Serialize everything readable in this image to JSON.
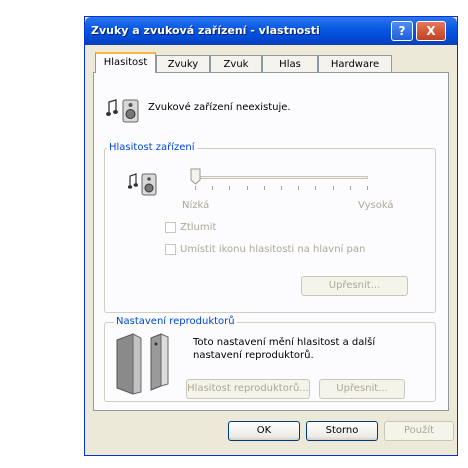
{
  "window": {
    "title": "Zvuky a zvuková zařízení - vlastnosti"
  },
  "titlebar": {
    "help_glyph": "?",
    "close_glyph": "X"
  },
  "tabs": [
    {
      "label": "Hlasitost",
      "active": true
    },
    {
      "label": "Zvuky"
    },
    {
      "label": "Zvuk"
    },
    {
      "label": "Hlas"
    },
    {
      "label": "Hardware"
    }
  ],
  "device": {
    "status_text": "Zvukové zařízení neexistuje."
  },
  "volume_group": {
    "label": "Hlasitost zařízení",
    "slider_low": "Nízká",
    "slider_high": "Vysoká",
    "slider_value": 0,
    "mute_label": "Ztlumit",
    "tray_icon_label": "Umístit ikonu hlasitosti na hlavní pan",
    "advanced_button": "Upřesnit..."
  },
  "speaker_group": {
    "label": "Nastavení reproduktorů",
    "description_line1": "Toto nastavení mění hlasitost a další",
    "description_line2": "nastavení reproduktorů.",
    "speaker_volume_button": "Hlasitost reproduktorů...",
    "advanced_button": "Upřesnit..."
  },
  "footer": {
    "ok": "OK",
    "cancel": "Storno",
    "apply": "Použít"
  },
  "icons": [
    "speaker-note-icon",
    "speaker-volume-icon",
    "speakers-pair-icon"
  ]
}
